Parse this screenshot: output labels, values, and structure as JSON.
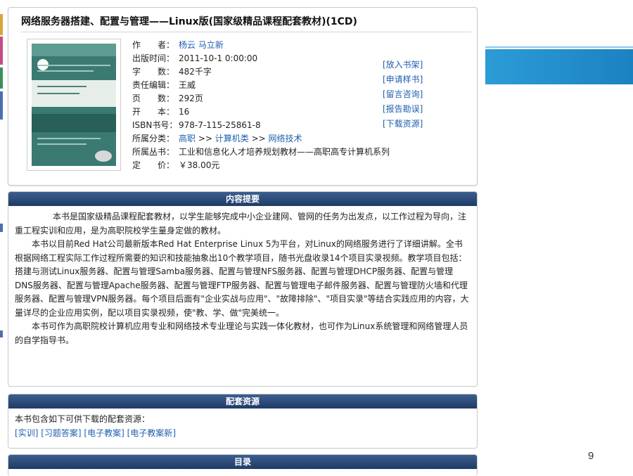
{
  "book": {
    "title": "网络服务器搭建、配置与管理——Linux版(国家级精品课程配套教材)(1CD)",
    "fields": [
      {
        "label": "作　　者：",
        "value": "杨云 马立新",
        "is_link": true
      },
      {
        "label": "出版时间：",
        "value": "2011-10-1 0:00:00",
        "is_link": false
      },
      {
        "label": "字　　数：",
        "value": "482千字",
        "is_link": false
      },
      {
        "label": "责任编辑：",
        "value": "王威",
        "is_link": false
      },
      {
        "label": "页　　数：",
        "value": "292页",
        "is_link": false
      },
      {
        "label": "开　　本：",
        "value": "16",
        "is_link": false
      },
      {
        "label": "ISBN书号：",
        "value": "978-7-115-25861-8",
        "is_link": false
      },
      {
        "label": "所属分类：",
        "value_parts": [
          "高职",
          " >> ",
          "计算机类",
          " >> ",
          "网络技术"
        ],
        "is_link": true
      },
      {
        "label": "所属丛书：",
        "value": "工业和信息化人才培养规划教材——高职高专计算机系列",
        "is_link": false
      },
      {
        "label": "定　　价：",
        "value": "￥38.00元",
        "is_link": false
      }
    ],
    "actions": [
      "[放入书架]",
      "[申请样书]",
      "[留言咨询]",
      "[报告勘误]",
      "[下载资源]"
    ]
  },
  "summary": {
    "header": "内容提要",
    "paragraphs": [
      "本书是国家级精品课程配套教材，以学生能够完成中小企业建网、管网的任务为出发点，以工作过程为导向，注重工程实训和应用，是为高职院校学生量身定做的教材。",
      "本书以目前Red Hat公司最新版本Red Hat Enterprise Linux 5为平台，对Linux的网络服务进行了详细讲解。全书根据网络工程实际工作过程所需要的知识和技能抽象出10个教学项目，随书光盘收录14个项目实录视频。教学项目包括：搭建与测试Linux服务器、配置与管理Samba服务器、配置与管理NFS服务器、配置与管理DHCP服务器、配置与管理DNS服务器、配置与管理Apache服务器、配置与管理FTP服务器、配置与管理电子邮件服务器、配置与管理防火墙和代理服务器、配置与管理VPN服务器。每个项目后面有\"企业实战与应用\"、\"故障排除\"、\"项目实录\"等结合实践应用的内容，大量详尽的企业应用实例，配以项目实录视频，使\"教、学、做\"完美统一。",
      "本书可作为高职院校计算机应用专业和网络技术专业理论与实践一体化教材，也可作为Linux系统管理和网络管理人员的自学指导书。"
    ]
  },
  "resources": {
    "header": "配套资源",
    "intro": "本书包含如下可供下载的配套资源：",
    "links": [
      "实训",
      "习题答案",
      "电子教案",
      "电子教案新"
    ]
  },
  "toc": {
    "header": "目录"
  },
  "slide": {
    "page_number": "9",
    "accent_color": "#1b82c2"
  }
}
